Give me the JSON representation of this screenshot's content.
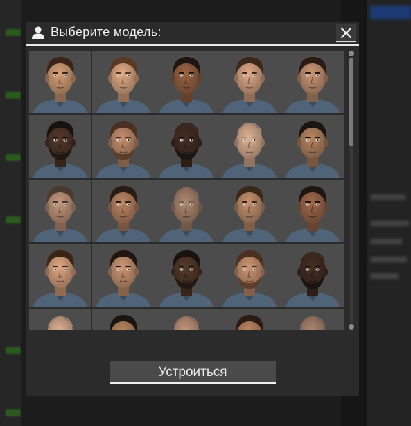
{
  "modal": {
    "title": "Выберите модель:",
    "close_label": "✕",
    "confirm_label": "Устроиться"
  },
  "models": [
    {
      "skin": "#c08f6c",
      "hair": "#3a2417",
      "beard": false,
      "bald": false
    },
    {
      "skin": "#c99a78",
      "hair": "#5b3a23",
      "beard": false,
      "bald": false
    },
    {
      "skin": "#8a5a3c",
      "hair": "#1e1410",
      "beard": false,
      "bald": false
    },
    {
      "skin": "#c8987a",
      "hair": "#3c281a",
      "beard": false,
      "bald": false
    },
    {
      "skin": "#b5876a",
      "hair": "#2a1a12",
      "beard": false,
      "bald": false
    },
    {
      "skin": "#4a3226",
      "hair": "#1a120e",
      "beard": true,
      "bald": false
    },
    {
      "skin": "#b08062",
      "hair": "#4a3020",
      "beard": true,
      "bald": false
    },
    {
      "skin": "#3e2a20",
      "hair": "#151010",
      "beard": true,
      "bald": true
    },
    {
      "skin": "#c8a086",
      "hair": "#b89a80",
      "beard": false,
      "bald": true
    },
    {
      "skin": "#a47858",
      "hair": "#1b1410",
      "beard": false,
      "bald": false
    },
    {
      "skin": "#b08870",
      "hair": "#4a3a30",
      "beard": false,
      "bald": false
    },
    {
      "skin": "#a8785a",
      "hair": "#2a1c14",
      "beard": false,
      "bald": false
    },
    {
      "skin": "#9c7a66",
      "hair": "#7a6a5c",
      "beard": false,
      "bald": true
    },
    {
      "skin": "#b08264",
      "hair": "#3a2818",
      "beard": false,
      "bald": false
    },
    {
      "skin": "#8e5e44",
      "hair": "#20150f",
      "beard": false,
      "bald": false
    },
    {
      "skin": "#c89474",
      "hair": "#3a2416",
      "beard": false,
      "bald": false
    },
    {
      "skin": "#b8886a",
      "hair": "#24160f",
      "beard": false,
      "bald": false
    },
    {
      "skin": "#4c3426",
      "hair": "#1a120e",
      "beard": true,
      "bald": false
    },
    {
      "skin": "#b88668",
      "hair": "#4a3020",
      "beard": true,
      "bald": false
    },
    {
      "skin": "#3e2a20",
      "hair": "#151010",
      "beard": true,
      "bald": true
    },
    {
      "skin": "#c8a086",
      "hair": "#b89a80",
      "beard": false,
      "bald": true
    },
    {
      "skin": "#a47858",
      "hair": "#1b1410",
      "beard": false,
      "bald": false
    },
    {
      "skin": "#b08870",
      "hair": "#4a3a30",
      "beard": false,
      "bald": true
    },
    {
      "skin": "#a8785a",
      "hair": "#2a1c14",
      "beard": false,
      "bald": false
    },
    {
      "skin": "#9c7a66",
      "hair": "#5a4a3c",
      "beard": false,
      "bald": true
    }
  ],
  "colors": {
    "modal_bg": "#2b2b2b",
    "tile_bg": "#4c4c4c",
    "accent_line": "#e6e6e6",
    "shirt": "#4f6478"
  },
  "icons": {
    "header": "user-icon",
    "close": "close-icon"
  }
}
